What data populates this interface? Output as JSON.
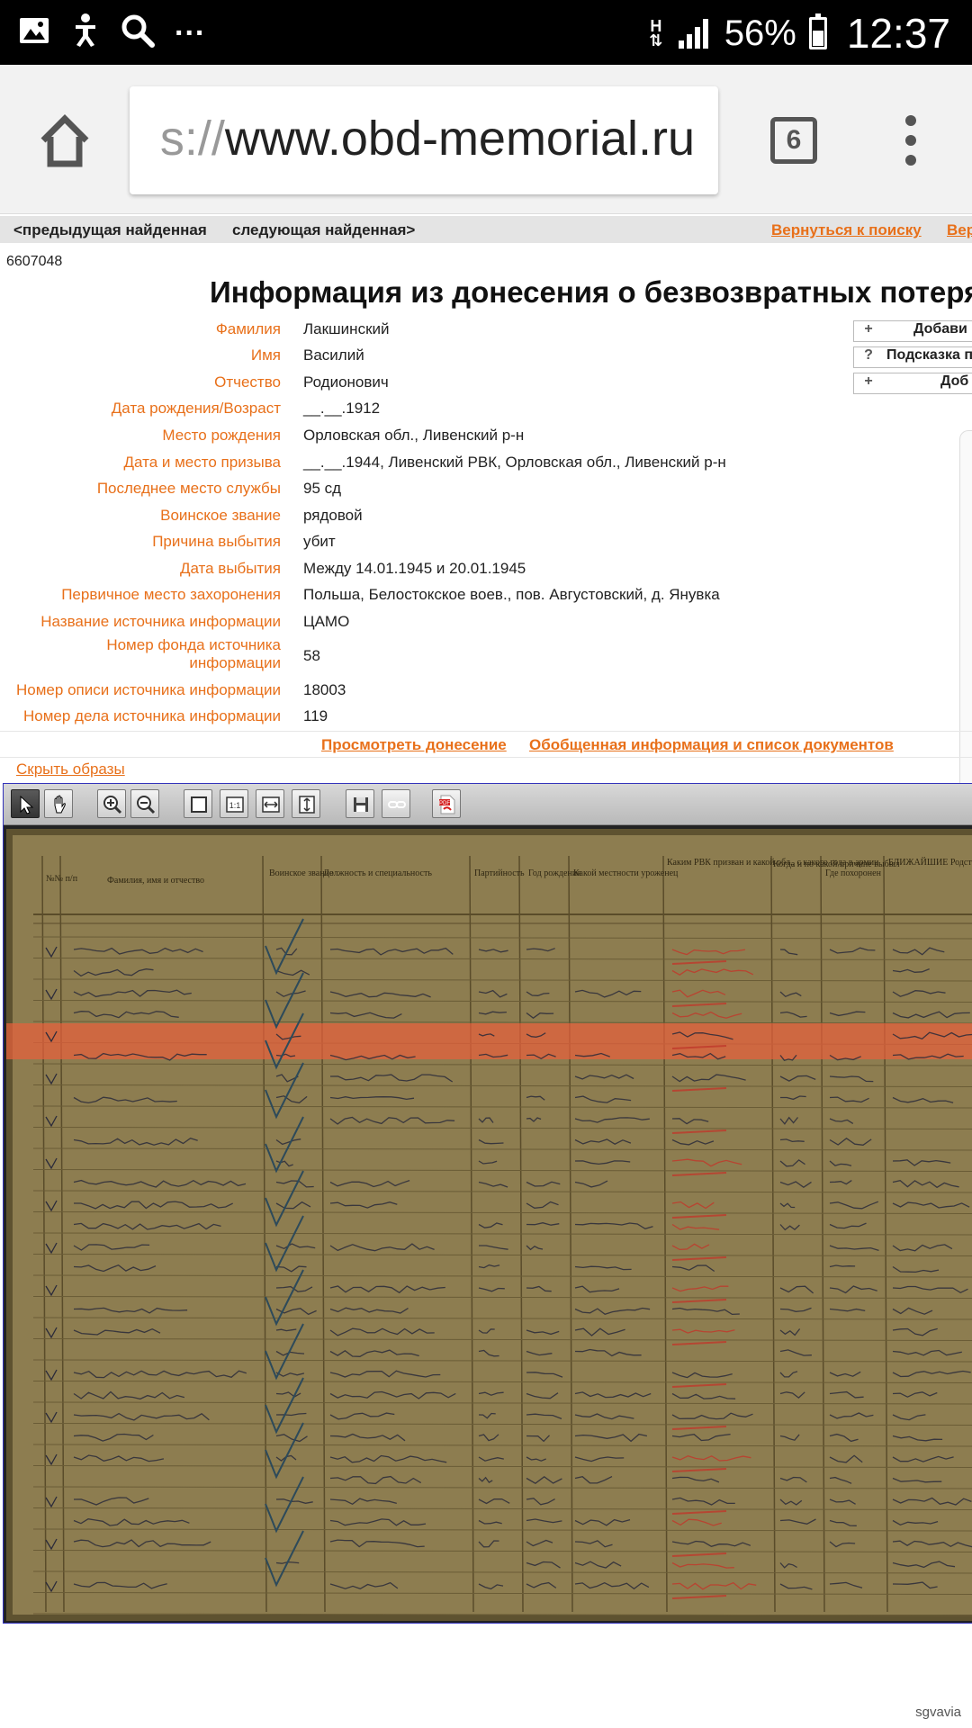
{
  "status_bar": {
    "network": "H",
    "battery": "56%",
    "battery_level": 0.56,
    "time": "12:37",
    "icons": [
      "gallery-icon",
      "accessibility-icon",
      "search-icon",
      "more-notifications-icon"
    ]
  },
  "browser": {
    "url_scheme": "s://",
    "url_host": "www.obd-memorial.ru",
    "tab_count": "6"
  },
  "nav": {
    "prev": "<предыдущая найденная",
    "next": "следующая найденная>",
    "back_to_search": "Вернуться к поиску",
    "cut_link": "Вер"
  },
  "record_id": "6607048",
  "title": "Информация из донесения о безвозвратных потеря",
  "fields": [
    {
      "label": "Фамилия",
      "value": "Лакшинский"
    },
    {
      "label": "Имя",
      "value": "Василий"
    },
    {
      "label": "Отчество",
      "value": "Родионович"
    },
    {
      "label": "Дата рождения/Возраст",
      "value": "__.__.1912"
    },
    {
      "label": "Место рождения",
      "value": "Орловская обл., Ливенский р-н"
    },
    {
      "label": "Дата и место призыва",
      "value": "__.__.1944, Ливенский РВК, Орловская обл., Ливенский р-н"
    },
    {
      "label": "Последнее место службы",
      "value": "95 сд"
    },
    {
      "label": "Воинское звание",
      "value": "рядовой"
    },
    {
      "label": "Причина выбытия",
      "value": "убит"
    },
    {
      "label": "Дата выбытия",
      "value": "Между 14.01.1945 и 20.01.1945"
    },
    {
      "label": "Первичное место захоронения",
      "value": "Польша, Белостокское воев., пов. Августовский, д. Янувка"
    },
    {
      "label": "Название источника информации",
      "value": "ЦАМО"
    },
    {
      "label": "Номер фонда источника информации",
      "value": "58"
    },
    {
      "label": "Номер описи источника информации",
      "value": "18003"
    },
    {
      "label": "Номер дела источника информации",
      "value": "119"
    }
  ],
  "side_buttons": [
    {
      "glyph": "+",
      "label": "Добави"
    },
    {
      "glyph": "?",
      "label": "Подсказка п"
    },
    {
      "glyph": "+",
      "label": "Доб"
    }
  ],
  "links": {
    "view_report": "Просмотреть донесение",
    "summary": "Обобщенная информация и список документов",
    "hide_images": "Скрыть образы"
  },
  "viewer": {
    "tools": [
      "pointer-icon",
      "hand-icon",
      "zoom-in-icon",
      "zoom-out-icon",
      "fit-page-icon",
      "actual-size-icon",
      "fit-width-icon",
      "fit-height-icon",
      "save-icon",
      "link-icon",
      "pdf-icon"
    ]
  },
  "document": {
    "headers": [
      "№№ п/п",
      "Фамилия, имя и отчество",
      "Воинское звание",
      "Должность и специальность",
      "Партийность",
      "Год рождения",
      "Какой местности уроженец",
      "Каким РВК призван и какой обл., с какого года в армии",
      "Когда и по какой причине выбыл",
      "Где похоронен",
      "БЛИЖАЙШИЕ Родственники"
    ],
    "highlight_color": "#e8603c"
  },
  "watermark": "sgvavia"
}
